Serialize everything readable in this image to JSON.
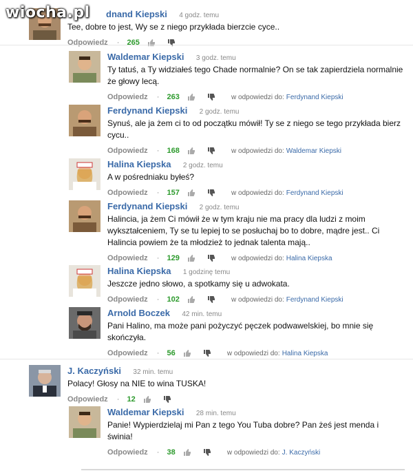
{
  "watermark": "wiocha.pl",
  "colors": {
    "name": "#3a6aa8",
    "score": "#2c9a2c",
    "muted": "#888888"
  },
  "labels": {
    "reply": "Odpowiedz",
    "in_reply_to": "w odpowiedzi do:"
  },
  "comments": [
    {
      "name": "dnand Kiepski",
      "time": "4 godz. temu",
      "text": "Tee, dobre to jest, Wy se z niego przykłada bierzcie cyce..",
      "score": "265",
      "reply_to": ""
    },
    {
      "name": "Waldemar Kiepski",
      "time": "3 godz. temu",
      "text": "Ty tatuś, a Ty widziałeś tego Chade normalnie? On se tak zapierdziela normalnie że głowy lecą.",
      "score": "263",
      "reply_to": "Ferdynand Kiepski"
    },
    {
      "name": "Ferdynand Kiepski",
      "time": "2 godz. temu",
      "text": "Synuś, ale ja żem ci to od początku mówił! Ty se z niego se tego przykłada bierz cycu..",
      "score": "168",
      "reply_to": "Waldemar Kiepski"
    },
    {
      "name": "Halina Kiepska",
      "time": "2 godz. temu",
      "text": "A w pośredniaku byłeś?",
      "score": "157",
      "reply_to": "Ferdynand Kiepski"
    },
    {
      "name": "Ferdynand Kiepski",
      "time": "2 godz. temu",
      "text": "Halincia, ja żem Ci mówił że w tym kraju nie ma pracy dla ludzi z moim wykształceniem, Ty se tu lepiej to se posłuchaj bo to dobre, mądre jest.. Ci Halincia powiem że ta młodzież to jednak talenta mają..",
      "score": "129",
      "reply_to": "Halina Kiepska"
    },
    {
      "name": "Halina Kiepska",
      "time": "1 godzinę temu",
      "text": "Jeszcze jedno słowo, a spotkamy się u adwokata.",
      "score": "102",
      "reply_to": "Ferdynand Kiepski"
    },
    {
      "name": "Arnold Boczek",
      "time": "42 min. temu",
      "text": "Pani Halino, ma może pani pożyczyć pęczek podwawelskiej, bo mnie się skończyła.",
      "score": "56",
      "reply_to": "Halina Kiepska"
    },
    {
      "name": "J. Kaczyński",
      "time": "32 min. temu",
      "text": "Polacy! Głosy na NIE to wina TUSKA!",
      "score": "12",
      "reply_to": ""
    },
    {
      "name": "Waldemar Kiepski",
      "time": "28 min. temu",
      "text": "Panie! Wypierdzielaj mi Pan z tego You Tuba dobre? Pan żeś jest menda i świnia!",
      "score": "38",
      "reply_to": "J. Kaczyński"
    }
  ]
}
